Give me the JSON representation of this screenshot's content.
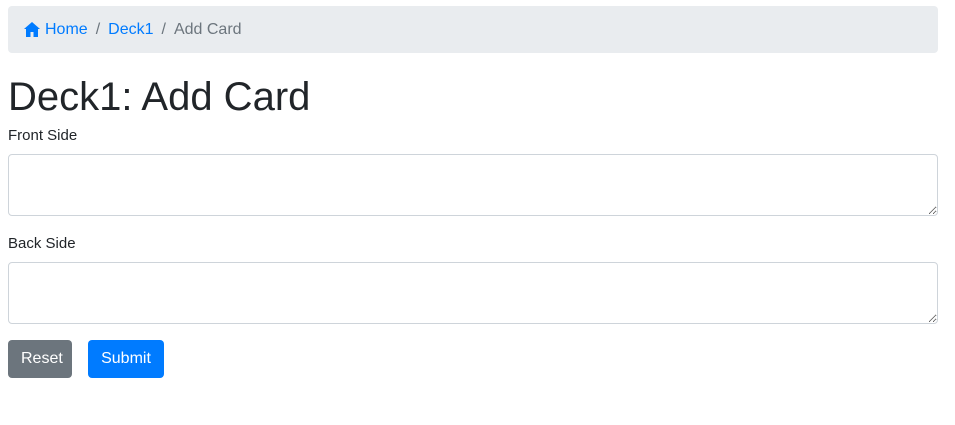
{
  "breadcrumb": {
    "home_label": "Home",
    "home_icon": "home-icon",
    "deck_label": "Deck1",
    "current_label": "Add Card",
    "separator": "/"
  },
  "page": {
    "title": "Deck1: Add Card"
  },
  "form": {
    "front_label": "Front Side",
    "front_value": "",
    "front_placeholder": "",
    "back_label": "Back Side",
    "back_value": "",
    "back_placeholder": "",
    "reset_label": "Reset",
    "submit_label": "Submit"
  },
  "colors": {
    "link": "#007bff",
    "breadcrumb_bg": "#e9ecef",
    "reset_button": "#6c757d",
    "submit_button": "#007bff"
  }
}
